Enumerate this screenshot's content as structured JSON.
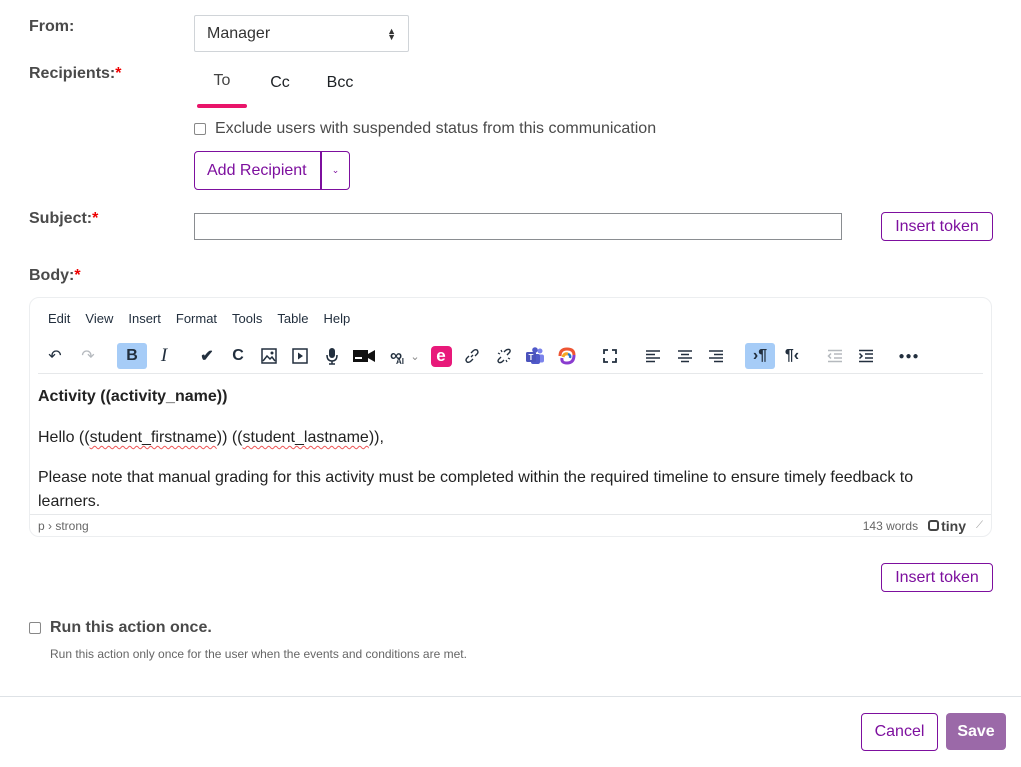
{
  "form": {
    "from_label": "From:",
    "from_value": "Manager",
    "recipients_label": "Recipients:",
    "required_mark": "*",
    "tabs": [
      {
        "label": "To",
        "active": true
      },
      {
        "label": "Cc",
        "active": false
      },
      {
        "label": "Bcc",
        "active": false
      }
    ],
    "exclude_label": "Exclude users with suspended status from this communication",
    "exclude_checked": false,
    "add_recipient_label": "Add Recipient",
    "subject_label": "Subject:",
    "subject_value": "",
    "insert_token_label": "Insert token",
    "body_label": "Body:"
  },
  "editor": {
    "menu": [
      "Edit",
      "View",
      "Insert",
      "Format",
      "Tools",
      "Table",
      "Help"
    ],
    "toolbar": [
      {
        "name": "undo-icon",
        "glyph": "↶",
        "state": "normal"
      },
      {
        "name": "redo-icon",
        "glyph": "↷",
        "state": "disabled"
      },
      {
        "name": "bold-icon",
        "glyph": "B",
        "state": "active"
      },
      {
        "name": "italic-icon",
        "glyph": "I",
        "state": "normal"
      },
      {
        "name": "accessibility-checker-icon",
        "glyph": "✔",
        "state": "normal"
      },
      {
        "name": "c-plugin-icon",
        "glyph": "C",
        "state": "normal"
      },
      {
        "name": "image-icon",
        "glyph": "🖼",
        "state": "normal"
      },
      {
        "name": "media-icon",
        "glyph": "▶",
        "state": "normal"
      },
      {
        "name": "microphone-icon",
        "glyph": "🎙",
        "state": "normal"
      },
      {
        "name": "video-camera-icon",
        "glyph": "■",
        "state": "normal"
      },
      {
        "name": "ai-assistant-icon",
        "glyph": "∞",
        "state": "normal"
      },
      {
        "name": "e-plugin-icon",
        "glyph": "e",
        "state": "normal"
      },
      {
        "name": "link-icon",
        "glyph": "🔗",
        "state": "normal"
      },
      {
        "name": "unlink-icon",
        "glyph": "⛓",
        "state": "normal"
      },
      {
        "name": "teams-icon",
        "glyph": "T",
        "state": "normal"
      },
      {
        "name": "colorful-swirl-icon",
        "glyph": "◎",
        "state": "normal"
      },
      {
        "name": "fullscreen-icon",
        "glyph": "⛶",
        "state": "normal"
      },
      {
        "name": "align-left-icon",
        "glyph": "≡",
        "state": "normal"
      },
      {
        "name": "align-center-icon",
        "glyph": "≡",
        "state": "normal"
      },
      {
        "name": "align-right-icon",
        "glyph": "≡",
        "state": "normal"
      },
      {
        "name": "ltr-icon",
        "glyph": "¶",
        "state": "active"
      },
      {
        "name": "rtl-icon",
        "glyph": "¶",
        "state": "normal"
      },
      {
        "name": "outdent-icon",
        "glyph": "⇤",
        "state": "disabled"
      },
      {
        "name": "indent-icon",
        "glyph": "⇥",
        "state": "normal"
      },
      {
        "name": "more-icon",
        "glyph": "•••",
        "state": "normal"
      }
    ],
    "content": {
      "heading": "Activity ((activity_name))",
      "greeting_prefix": "Hello ((",
      "token1": "student_firstname",
      "mid": ")) ((",
      "token2": "student_lastname",
      "greeting_suffix": ")),",
      "paragraph": "Please note that manual grading for this activity must be completed within the required timeline to ensure timely feedback to learners."
    },
    "path": "p › strong",
    "word_count": "143 words",
    "brand": "tiny"
  },
  "run_once": {
    "label": "Run this action once.",
    "hint": "Run this action only once for the user when the events and conditions are met.",
    "checked": false
  },
  "footer": {
    "cancel_label": "Cancel",
    "save_label": "Save"
  }
}
